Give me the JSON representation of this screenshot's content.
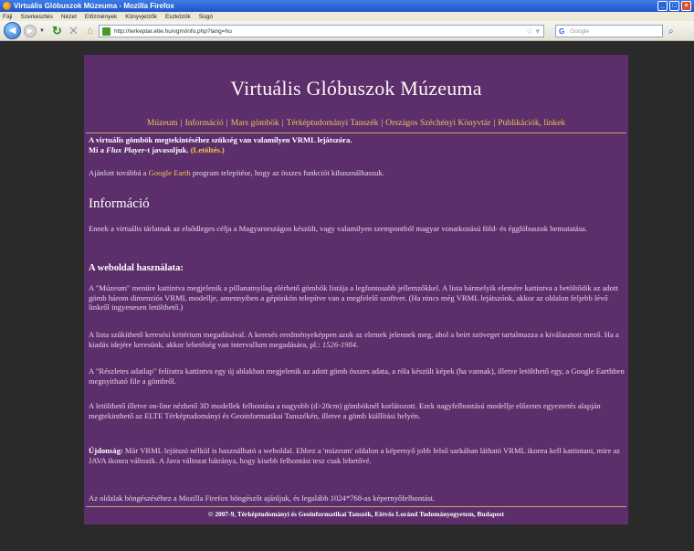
{
  "browser": {
    "window_title": "Virtuális Glóbuszok Múzeuma - Mozilla Firefox",
    "menu": [
      "Fájl",
      "Szerkesztés",
      "Nézet",
      "Előzmények",
      "Könyvjelzők",
      "Eszközök",
      "Súgó"
    ],
    "url": "http://terkeptar.elte.hu/vgm/info.php?lang=hu",
    "search_placeholder": "Google",
    "search_engine_icon": "G"
  },
  "page": {
    "title": "Virtuális Glóbuszok Múzeuma",
    "nav": [
      "Múzeum",
      "Információ",
      "Mars gömbök",
      "Térképtudományi Tanszék",
      "Országos Széchényi Könyvtár",
      "Publikációk, linkek"
    ],
    "nav_separator": "|",
    "vrml_notice_line1": "A virtuális gömbök megtekintéséhez szükség van valamilyen VRML lejátszóra.",
    "vrml_notice_pre": "Mi a ",
    "vrml_player_name": "Flux Player",
    "vrml_notice_mid": "-t javasoljuk.",
    "download_link": "(Letöltés.)",
    "ge_pre": "Ajánlott továbbá a ",
    "ge_link": "Google Earth",
    "ge_post": " program telepítése, hogy az összes funkciót kihasználhassuk.",
    "info_heading": "Információ",
    "intro": "Ennek a virtuális tárlatnak az elsődleges célja a Magyarországon készült, vagy valamilyen szempontból magyar vonatkozású föld- és égglóbuszok bemutatása.",
    "usage_heading": "A weboldal használata:",
    "p1": "A \"Múzeum\" menüre kattintva megjelenik a pillanatnyilag elérhető gömbök listája a legfontosabb jellemzőkkel. A lista bármelyik elemére kattintva a betöltődik az adott gömb három dimenziós VRML modellje, amennyiben a gépünkön telepítve van a megfelelő szoftver. (Ha nincs még VRML lejátszónk, akkor az oldalon feljebb lévő linkről ingyenesen letölthető.)",
    "p2_main": "A lista szűkíthető keresési kritérium megadásával. A keresés eredményeképpen azok az elemek jelennek meg, ahol a beírt szöveget tartalmazza a kiválasztott mező. Ha a kiadás idejére keresünk, akkor lehetőség van intervallum megadására, pl.: ",
    "p2_example": "1526-1984",
    "p2_end": ".",
    "p3": "A \"Részletes adatlap\" felíratra kattintva egy új ablakban megjelenik az adott gömb összes adata, a róla készült képek (ha vannak), illetve letölthető egy, a Google Earthben megnyitható file a gömbről.",
    "p4": "A letölthető illetve on-line nézhető 3D modellek felbontása a nagyobb (d>20cm) gömböknél korlátozott. Ezek nagyfelbontású modellje előzetes egyeztetés alapján megtekinthető az ELTE Térképtudományi és Geoinformatikai Tanszékén, illetve a gömb kiállítási helyén.",
    "p5_bold": "Újdonság:",
    "p5_rest": " Már VRML lejátszó nélkül is használható a weboldal. Ehhez a 'múzeum' oldalon a képernyő jobb felső sarkában látható VRML ikonra kell kattintani, mire az JAVA ikonra változik. A Java változat hátránya, hogy kisebb felbontást tesz csak lehetővé.",
    "p6": "Az oldalak böngészéséhez a Mozilla Firefox böngészőt ajánljuk, és legalább 1024*768-as képernyőfelbontást.",
    "footer": "© 2007-9, Térképtudományi és Geoinformatikai Tanszék, Eötvös Loránd Tudományegyetem, Budapest"
  },
  "colors": {
    "page_bg": "#5c2e6b",
    "outer_bg": "#2a2a2a",
    "link": "#f2c25a",
    "download": "#f7cf3c",
    "text": "#ead7ea"
  }
}
